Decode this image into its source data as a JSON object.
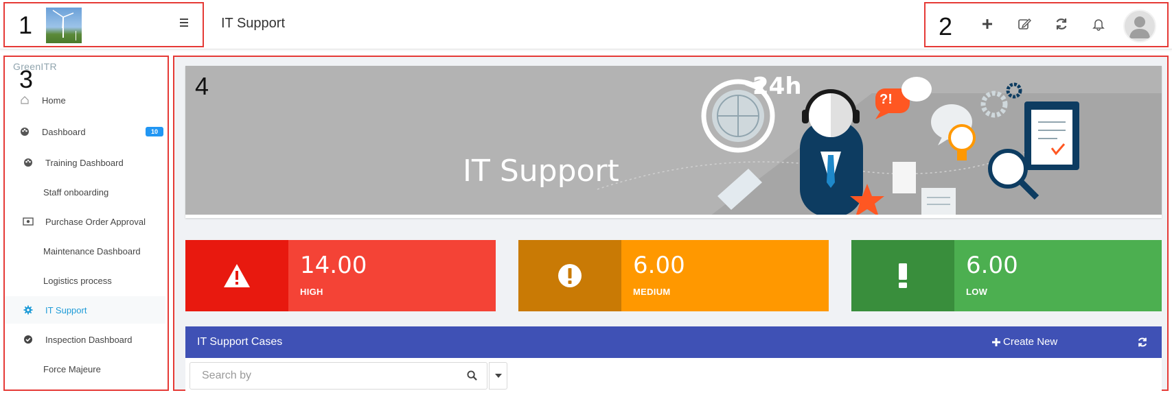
{
  "callouts": {
    "c1": "1",
    "c2": "2",
    "c3": "3",
    "c4": "4"
  },
  "header": {
    "app_title": "IT Support",
    "tools": [
      "plus-icon",
      "edit-icon",
      "refresh-icon",
      "bell-icon",
      "avatar"
    ]
  },
  "sidebar": {
    "company": "GreenITR",
    "items": [
      {
        "label": "Home",
        "icon": "home-icon"
      },
      {
        "label": "Dashboard",
        "icon": "palette-icon",
        "badge": "10"
      },
      {
        "label": "Training Dashboard",
        "icon": "palette-icon"
      },
      {
        "label": "Staff onboarding",
        "icon": ""
      },
      {
        "label": "Purchase Order Approval",
        "icon": "money-icon"
      },
      {
        "label": "Maintenance Dashboard",
        "icon": ""
      },
      {
        "label": "Logistics process",
        "icon": ""
      },
      {
        "label": "IT Support",
        "icon": "gear-icon",
        "active": true
      },
      {
        "label": "Inspection Dashboard",
        "icon": "check-circle-icon"
      },
      {
        "label": "Force Majeure",
        "icon": ""
      }
    ]
  },
  "banner": {
    "title": "IT Support",
    "badge_24h": "24h",
    "bubble": "?!"
  },
  "kpis": [
    {
      "value": "14.00",
      "label": "HIGH",
      "color": "#f44336",
      "icon_bg": "#e8190f",
      "icon": "warning-icon"
    },
    {
      "value": "6.00",
      "label": "MEDIUM",
      "color": "#ff9800",
      "icon_bg": "#c97a05",
      "icon": "exclamation-circle-icon"
    },
    {
      "value": "6.00",
      "label": "LOW",
      "color": "#4caf50",
      "icon_bg": "#398e3c",
      "icon": "exclamation-icon"
    }
  ],
  "cases": {
    "title": "IT Support Cases",
    "create_new": "Create New",
    "search_placeholder": "Search by"
  }
}
